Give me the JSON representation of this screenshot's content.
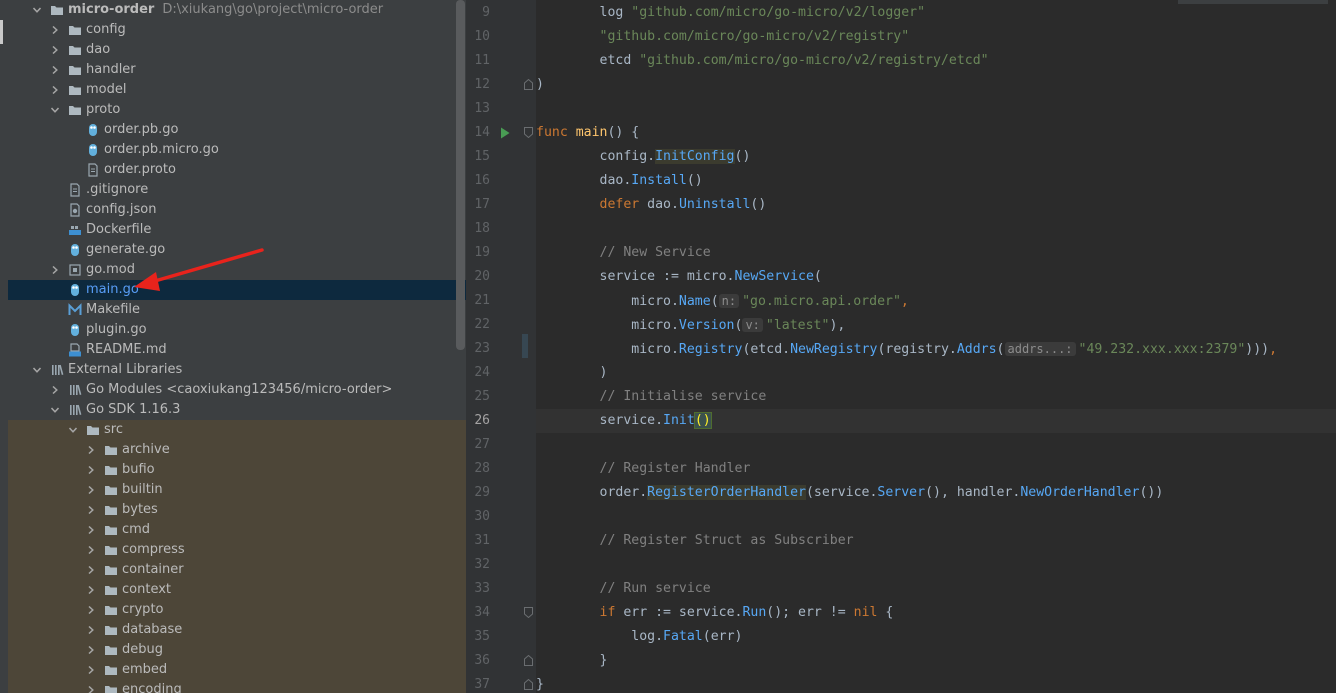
{
  "project_tree": {
    "rows": [
      {
        "kind": "folder",
        "label": "micro-order",
        "hint": "D:\\xiukang\\go\\project\\micro-order",
        "depth": 0,
        "arrow": "down",
        "bold": true
      },
      {
        "kind": "folder",
        "label": "config",
        "depth": 1,
        "arrow": "right"
      },
      {
        "kind": "folder",
        "label": "dao",
        "depth": 1,
        "arrow": "right"
      },
      {
        "kind": "folder",
        "label": "handler",
        "depth": 1,
        "arrow": "right"
      },
      {
        "kind": "folder",
        "label": "model",
        "depth": 1,
        "arrow": "right"
      },
      {
        "kind": "folder",
        "label": "proto",
        "depth": 1,
        "arrow": "down"
      },
      {
        "kind": "go",
        "label": "order.pb.go",
        "depth": 2
      },
      {
        "kind": "go",
        "label": "order.pb.micro.go",
        "depth": 2
      },
      {
        "kind": "text",
        "label": "order.proto",
        "depth": 2
      },
      {
        "kind": "text",
        "label": ".gitignore",
        "depth": 1
      },
      {
        "kind": "json",
        "label": "config.json",
        "depth": 1
      },
      {
        "kind": "docker",
        "label": "Dockerfile",
        "depth": 1
      },
      {
        "kind": "go",
        "label": "generate.go",
        "depth": 1
      },
      {
        "kind": "gomod",
        "label": "go.mod",
        "depth": 1,
        "arrow": "right"
      },
      {
        "kind": "go",
        "label": "main.go",
        "depth": 1,
        "selected": true
      },
      {
        "kind": "make",
        "label": "Makefile",
        "depth": 1
      },
      {
        "kind": "go",
        "label": "plugin.go",
        "depth": 1
      },
      {
        "kind": "md",
        "label": "README.md",
        "depth": 1
      },
      {
        "kind": "lib",
        "label": "External Libraries",
        "depth": 0,
        "arrow": "down"
      },
      {
        "kind": "lib",
        "label": "Go Modules <caoxiukang123456/micro-order>",
        "depth": 1,
        "arrow": "right"
      },
      {
        "kind": "lib",
        "label": "Go SDK 1.16.3",
        "depth": 1,
        "arrow": "down"
      },
      {
        "kind": "folder",
        "label": "src",
        "depth": 2,
        "arrow": "down",
        "sdk": true
      },
      {
        "kind": "folder",
        "label": "archive",
        "depth": 3,
        "arrow": "right",
        "sdk": true
      },
      {
        "kind": "folder",
        "label": "bufio",
        "depth": 3,
        "arrow": "right",
        "sdk": true
      },
      {
        "kind": "folder",
        "label": "builtin",
        "depth": 3,
        "arrow": "right",
        "sdk": true
      },
      {
        "kind": "folder",
        "label": "bytes",
        "depth": 3,
        "arrow": "right",
        "sdk": true
      },
      {
        "kind": "folder",
        "label": "cmd",
        "depth": 3,
        "arrow": "right",
        "sdk": true
      },
      {
        "kind": "folder",
        "label": "compress",
        "depth": 3,
        "arrow": "right",
        "sdk": true
      },
      {
        "kind": "folder",
        "label": "container",
        "depth": 3,
        "arrow": "right",
        "sdk": true
      },
      {
        "kind": "folder",
        "label": "context",
        "depth": 3,
        "arrow": "right",
        "sdk": true
      },
      {
        "kind": "folder",
        "label": "crypto",
        "depth": 3,
        "arrow": "right",
        "sdk": true
      },
      {
        "kind": "folder",
        "label": "database",
        "depth": 3,
        "arrow": "right",
        "sdk": true
      },
      {
        "kind": "folder",
        "label": "debug",
        "depth": 3,
        "arrow": "right",
        "sdk": true
      },
      {
        "kind": "folder",
        "label": "embed",
        "depth": 3,
        "arrow": "right",
        "sdk": true
      },
      {
        "kind": "folder",
        "label": "encoding",
        "depth": 3,
        "arrow": "right",
        "sdk": true
      }
    ]
  },
  "editor": {
    "current_line": 26,
    "lines": [
      {
        "n": 9,
        "seg": [
          [
            "",
            "        "
          ],
          [
            "",
            "log "
          ],
          [
            "str",
            "\"github.com/micro/go-micro/v2/logger\""
          ]
        ]
      },
      {
        "n": 10,
        "seg": [
          [
            "",
            "        "
          ],
          [
            "str",
            "\"github.com/micro/go-micro/v2/registry\""
          ]
        ]
      },
      {
        "n": 11,
        "seg": [
          [
            "",
            "        "
          ],
          [
            "",
            "etcd "
          ],
          [
            "str",
            "\"github.com/micro/go-micro/v2/registry/etcd\""
          ]
        ]
      },
      {
        "n": 12,
        "seg": [
          [
            "",
            ")"
          ]
        ]
      },
      {
        "n": 13,
        "seg": []
      },
      {
        "n": 14,
        "seg": [
          [
            "kw",
            "func "
          ],
          [
            "fn",
            "main"
          ],
          [
            "",
            "() {"
          ]
        ]
      },
      {
        "n": 15,
        "seg": [
          [
            "",
            "        config."
          ],
          [
            "call hl",
            "InitConfig"
          ],
          [
            "",
            "()"
          ]
        ]
      },
      {
        "n": 16,
        "seg": [
          [
            "",
            "        dao."
          ],
          [
            "call",
            "Install"
          ],
          [
            "",
            "()"
          ]
        ]
      },
      {
        "n": 17,
        "seg": [
          [
            "",
            "        "
          ],
          [
            "kw",
            "defer "
          ],
          [
            "",
            "dao."
          ],
          [
            "call",
            "Uninstall"
          ],
          [
            "",
            "()"
          ]
        ]
      },
      {
        "n": 18,
        "seg": []
      },
      {
        "n": 19,
        "seg": [
          [
            "",
            "        "
          ],
          [
            "cm",
            "// New Service"
          ]
        ]
      },
      {
        "n": 20,
        "seg": [
          [
            "",
            "        service := micro."
          ],
          [
            "call",
            "NewService"
          ],
          [
            "",
            "("
          ]
        ]
      },
      {
        "n": 21,
        "seg": [
          [
            "",
            "            micro."
          ],
          [
            "call",
            "Name"
          ],
          [
            "",
            "("
          ],
          [
            "ihint",
            "n:"
          ],
          [
            "str",
            "\"go.micro.api.order\""
          ],
          [
            "kw",
            ","
          ]
        ]
      },
      {
        "n": 22,
        "seg": [
          [
            "",
            "            micro."
          ],
          [
            "call",
            "Version"
          ],
          [
            "",
            "("
          ],
          [
            "ihint",
            "v:"
          ],
          [
            "str",
            "\"latest\""
          ],
          [
            "",
            "),"
          ]
        ]
      },
      {
        "n": 23,
        "seg": [
          [
            "",
            "            micro."
          ],
          [
            "call",
            "Registry"
          ],
          [
            "",
            "(etcd."
          ],
          [
            "call",
            "NewRegistry"
          ],
          [
            "",
            "(registry."
          ],
          [
            "call",
            "Addrs"
          ],
          [
            "",
            "("
          ],
          [
            "ihint",
            "addrs...:"
          ],
          [
            "str",
            "\"49.232.xxx.xxx:2379\""
          ],
          [
            "",
            ")))"
          ],
          [
            "kw",
            ","
          ]
        ]
      },
      {
        "n": 24,
        "seg": [
          [
            "",
            "        )"
          ]
        ]
      },
      {
        "n": 25,
        "seg": [
          [
            "",
            "        "
          ],
          [
            "cm",
            "// Initialise service"
          ]
        ]
      },
      {
        "n": 26,
        "seg": [
          [
            "",
            "        service."
          ],
          [
            "call",
            "Init"
          ],
          [
            "bm",
            "()"
          ]
        ]
      },
      {
        "n": 27,
        "seg": []
      },
      {
        "n": 28,
        "seg": [
          [
            "",
            "        "
          ],
          [
            "cm",
            "// Register Handler"
          ]
        ]
      },
      {
        "n": 29,
        "seg": [
          [
            "",
            "        order."
          ],
          [
            "call hl",
            "RegisterOrderHandler"
          ],
          [
            "",
            "(service."
          ],
          [
            "call",
            "Server"
          ],
          [
            "",
            "(), handler."
          ],
          [
            "call",
            "NewOrderHandler"
          ],
          [
            "",
            "())"
          ]
        ]
      },
      {
        "n": 30,
        "seg": []
      },
      {
        "n": 31,
        "seg": [
          [
            "",
            "        "
          ],
          [
            "cm",
            "// Register Struct as Subscriber"
          ]
        ]
      },
      {
        "n": 32,
        "seg": []
      },
      {
        "n": 33,
        "seg": [
          [
            "",
            "        "
          ],
          [
            "cm",
            "// Run service"
          ]
        ]
      },
      {
        "n": 34,
        "seg": [
          [
            "",
            "        "
          ],
          [
            "kw",
            "if "
          ],
          [
            "",
            "err := service."
          ],
          [
            "call",
            "Run"
          ],
          [
            "",
            "(); err != "
          ],
          [
            "kw",
            "nil "
          ],
          [
            "",
            "{"
          ]
        ]
      },
      {
        "n": 35,
        "seg": [
          [
            "",
            "            log."
          ],
          [
            "call",
            "Fatal"
          ],
          [
            "",
            "(err)"
          ]
        ]
      },
      {
        "n": 36,
        "seg": [
          [
            "",
            "        }"
          ]
        ]
      },
      {
        "n": 37,
        "seg": [
          [
            "",
            "}"
          ]
        ]
      }
    ]
  },
  "colors": {
    "annotation_arrow": "#e8231c",
    "go_icon": "#62b0dd",
    "folder_icon": "#aeb9c0",
    "run_icon": "#499c54"
  }
}
